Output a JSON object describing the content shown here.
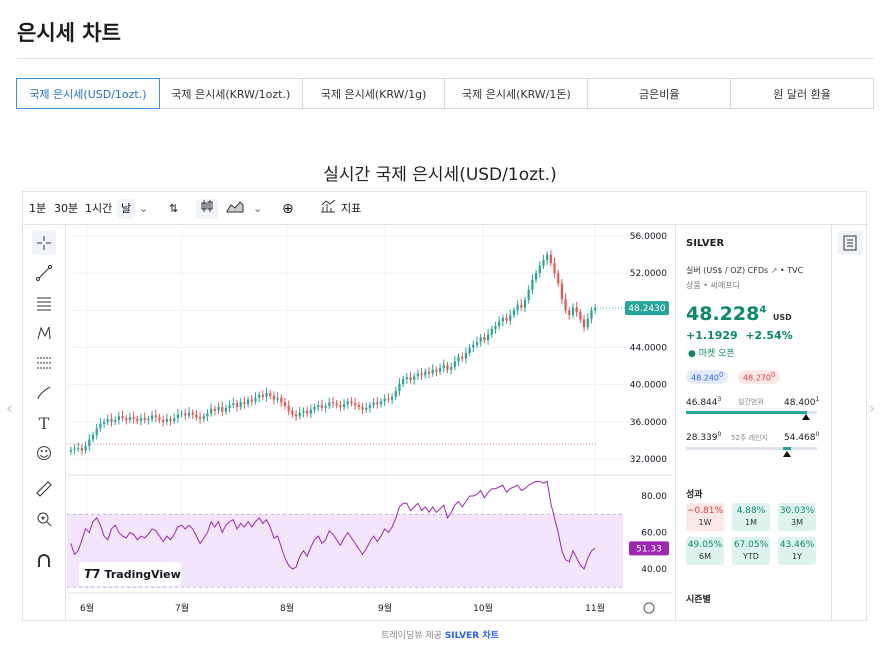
{
  "page": {
    "title": "은시세 차트"
  },
  "tabs": [
    {
      "label": "국제 은시세(USD/1ozt.)",
      "active": true
    },
    {
      "label": "국제 은시세(KRW/1ozt.)",
      "active": false
    },
    {
      "label": "국제 은시세(KRW/1g)",
      "active": false
    },
    {
      "label": "국제 은시세(KRW/1돈)",
      "active": false
    },
    {
      "label": "금은비율",
      "active": false
    },
    {
      "label": "원 달러 환율",
      "active": false
    }
  ],
  "chart_heading": "실시간 국제 은시세(USD/1ozt.)",
  "toolbar": {
    "intervals": [
      "1분",
      "30분",
      "1시간",
      "날"
    ],
    "indicators_label": "지표"
  },
  "price_axis": {
    "ticks": [
      "56.0000",
      "52.0000",
      "48.0000",
      "44.0000",
      "40.0000",
      "36.0000",
      "32.0000"
    ],
    "current_label": "48.2430"
  },
  "rsi_axis": {
    "ticks": [
      "80.00",
      "60.00",
      "40.00"
    ],
    "current_label": "51.33"
  },
  "time_axis": [
    "6월",
    "7월",
    "8월",
    "9월",
    "10월",
    "11월"
  ],
  "watermark": "TradingView",
  "symbol_panel": {
    "symbol": "SILVER",
    "name": "실버 (US$ / OZ) CFDs",
    "source": "TVC",
    "category": "상품 • 씨에프디",
    "price": "48.228",
    "price_sup": "4",
    "currency": "USD",
    "change": "+1.1929",
    "change_pct": "+2.54%",
    "market_status": "마켓 오픈",
    "bid": "48.240",
    "bid_sup": "0",
    "ask": "48.270",
    "ask_sup": "0",
    "day_low": "46.844",
    "day_low_sup": "3",
    "day_range_label": "일간범위",
    "day_high": "48.400",
    "day_high_sup": "1",
    "week52_low": "28.339",
    "week52_low_sup": "0",
    "week52_label": "52주 레인지",
    "week52_high": "54.468",
    "week52_high_sup": "0",
    "performance_title": "성과",
    "performance": [
      {
        "value": "−0.81%",
        "label": "1W"
      },
      {
        "value": "4.88%",
        "label": "1M"
      },
      {
        "value": "30.03%",
        "label": "3M"
      },
      {
        "value": "49.05%",
        "label": "6M"
      },
      {
        "value": "67.05%",
        "label": "YTD"
      },
      {
        "value": "43.46%",
        "label": "1Y"
      }
    ],
    "seasonal_title": "시즌별"
  },
  "caption": {
    "prefix": "트레이딩뷰 제공",
    "link": "SILVER 차트"
  },
  "colors": {
    "up": "#26a69a",
    "down": "#ef5350",
    "rsi_line": "#9c27b0",
    "rsi_band": "#f3e5fc",
    "accent": "#2962ff"
  },
  "chart_data": {
    "type": "candlestick",
    "xlabel": "",
    "ylabel": "",
    "ylim": [
      30,
      57
    ],
    "x": [
      "6월",
      "7월",
      "8월",
      "9월",
      "10월",
      "11월"
    ],
    "close": [
      33.0,
      33.1,
      33.2,
      32.9,
      33.4,
      34.1,
      34.6,
      35.3,
      35.8,
      36.0,
      36.3,
      36.0,
      36.2,
      36.6,
      36.4,
      36.2,
      36.5,
      36.3,
      36.1,
      36.4,
      36.2,
      36.3,
      36.7,
      36.5,
      36.2,
      36.0,
      36.3,
      36.1,
      36.4,
      36.8,
      36.9,
      36.7,
      37.0,
      36.8,
      36.5,
      36.3,
      36.6,
      36.9,
      37.4,
      37.2,
      37.6,
      37.1,
      37.5,
      37.8,
      38.0,
      37.6,
      38.1,
      37.9,
      38.4,
      38.2,
      38.6,
      38.9,
      38.7,
      39.1,
      38.8,
      38.4,
      38.6,
      38.1,
      37.7,
      37.2,
      36.8,
      36.6,
      37.0,
      37.2,
      36.9,
      37.3,
      37.6,
      37.8,
      37.5,
      37.7,
      38.1,
      38.0,
      37.8,
      37.6,
      37.9,
      38.2,
      38.0,
      37.8,
      37.6,
      37.3,
      37.5,
      37.8,
      38.1,
      37.9,
      38.2,
      38.5,
      38.4,
      38.7,
      39.3,
      40.1,
      40.6,
      40.8,
      40.5,
      40.9,
      41.2,
      41.0,
      41.4,
      41.2,
      41.6,
      41.4,
      41.8,
      42.1,
      41.6,
      41.9,
      42.5,
      43.0,
      42.8,
      43.4,
      44.0,
      44.3,
      44.6,
      45.1,
      44.8,
      45.4,
      46.0,
      46.3,
      46.8,
      47.2,
      46.9,
      47.5,
      48.0,
      48.6,
      48.3,
      49.1,
      50.2,
      51.3,
      52.0,
      52.8,
      53.4,
      54.0,
      53.1,
      52.0,
      50.9,
      49.2,
      48.0,
      47.5,
      48.3,
      47.8,
      47.0,
      46.2,
      47.1,
      48.0,
      48.24
    ],
    "rsi": [
      54,
      48,
      50,
      56,
      62,
      60,
      66,
      68,
      64,
      58,
      56,
      62,
      64,
      60,
      58,
      57,
      60,
      59,
      56,
      58,
      57,
      59,
      62,
      61,
      58,
      55,
      58,
      56,
      59,
      63,
      64,
      62,
      64,
      62,
      58,
      54,
      57,
      60,
      66,
      63,
      66,
      60,
      64,
      66,
      67,
      62,
      65,
      63,
      66,
      63,
      66,
      68,
      65,
      67,
      63,
      57,
      58,
      52,
      46,
      42,
      40,
      41,
      47,
      50,
      47,
      52,
      56,
      58,
      54,
      56,
      61,
      59,
      56,
      53,
      57,
      60,
      57,
      54,
      51,
      48,
      51,
      55,
      58,
      55,
      58,
      62,
      60,
      63,
      68,
      74,
      76,
      76,
      72,
      74,
      76,
      72,
      74,
      71,
      74,
      71,
      73,
      75,
      68,
      71,
      75,
      77,
      74,
      77,
      80,
      80,
      81,
      83,
      79,
      82,
      84,
      84,
      85,
      86,
      82,
      84,
      85,
      86,
      83,
      84,
      86,
      87,
      88,
      88,
      87,
      88,
      76,
      68,
      60,
      50,
      45,
      44,
      50,
      46,
      42,
      40,
      46,
      50,
      51.33
    ]
  }
}
